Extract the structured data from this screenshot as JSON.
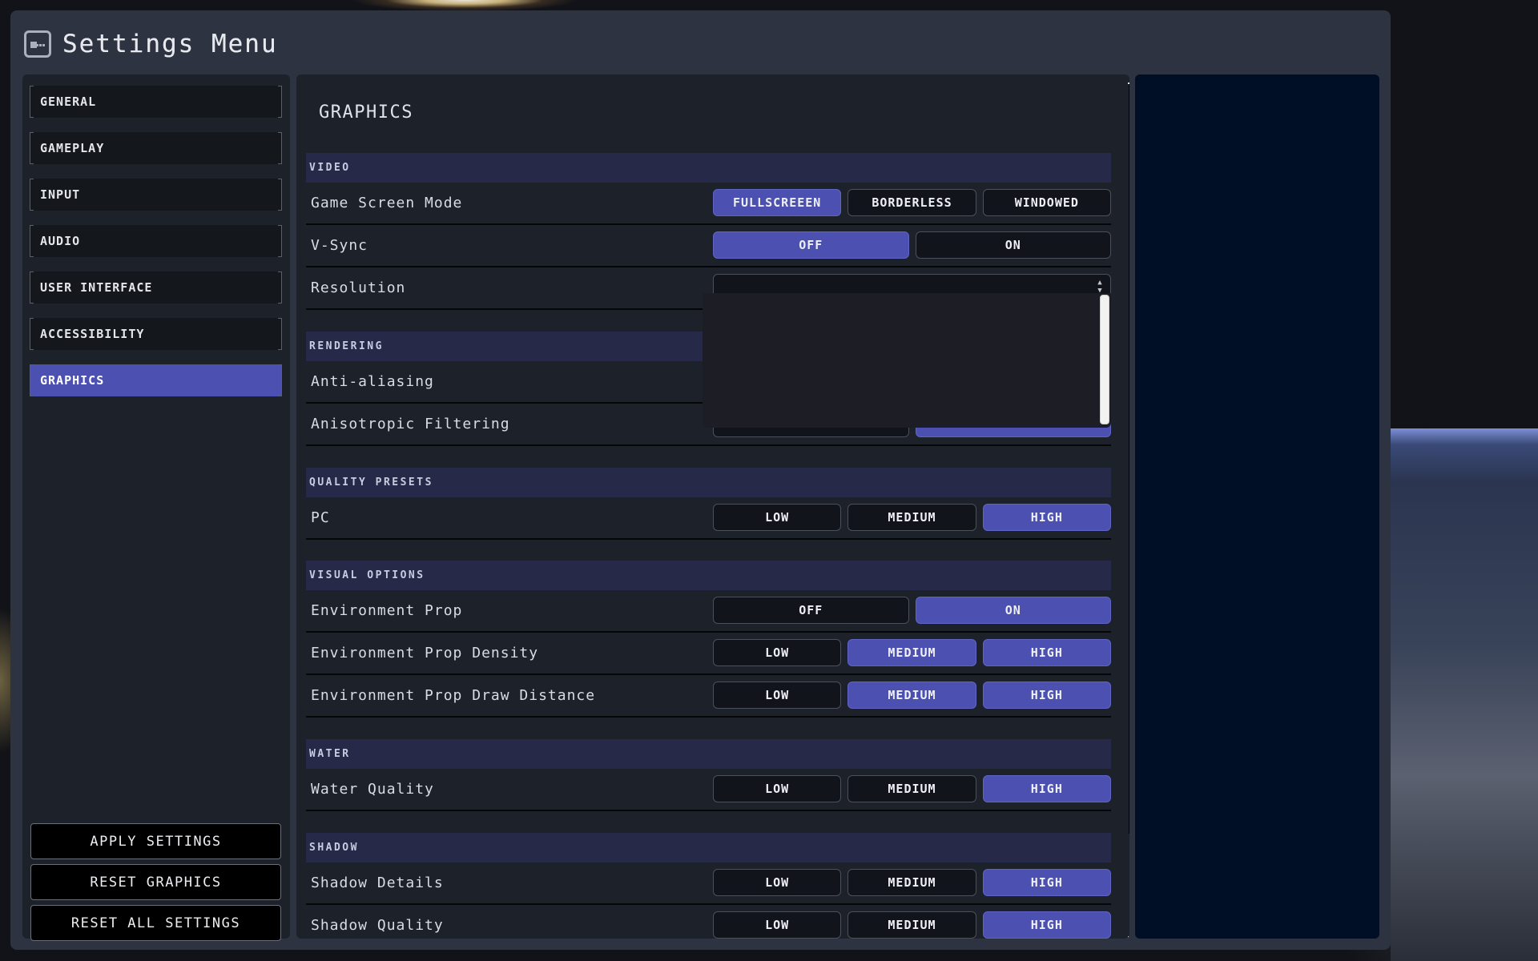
{
  "window": {
    "title": "Settings Menu",
    "title_icon": "back-arrow-icon"
  },
  "sidebar": {
    "items": [
      {
        "label": "GENERAL",
        "active": false
      },
      {
        "label": "GAMEPLAY",
        "active": false
      },
      {
        "label": "INPUT",
        "active": false
      },
      {
        "label": "AUDIO",
        "active": false
      },
      {
        "label": "USER INTERFACE",
        "active": false
      },
      {
        "label": "ACCESSIBILITY",
        "active": false
      },
      {
        "label": "GRAPHICS",
        "active": true
      }
    ],
    "actions": {
      "apply": "APPLY SETTINGS",
      "reset_graphics": "RESET GRAPHICS",
      "reset_all": "RESET ALL SETTINGS"
    }
  },
  "main": {
    "title": "GRAPHICS",
    "sections": {
      "video": {
        "header": "VIDEO",
        "screen_mode": {
          "label": "Game Screen Mode",
          "options": [
            "FULLSCREEEN",
            "BORDERLESS",
            "WINDOWED"
          ],
          "selected": "FULLSCREEEN"
        },
        "vsync": {
          "label": "V-Sync",
          "options": [
            "OFF",
            "ON"
          ],
          "selected": "OFF"
        },
        "resolution": {
          "label": "Resolution",
          "value": "",
          "dropdown_open": true
        }
      },
      "rendering": {
        "header": "RENDERING",
        "anti_aliasing": {
          "label": "Anti-aliasing"
        },
        "anisotropic": {
          "label": "Anisotropic Filtering"
        }
      },
      "quality_presets": {
        "header": "QUALITY PRESETS",
        "pc": {
          "label": "PC",
          "options": [
            "LOW",
            "MEDIUM",
            "HIGH"
          ],
          "selected": [
            "HIGH"
          ]
        }
      },
      "visual_options": {
        "header": "VISUAL OPTIONS",
        "env_prop": {
          "label": "Environment Prop",
          "options": [
            "OFF",
            "ON"
          ],
          "selected": [
            "ON"
          ]
        },
        "env_prop_density": {
          "label": "Environment Prop Density",
          "options": [
            "LOW",
            "MEDIUM",
            "HIGH"
          ],
          "selected": [
            "MEDIUM",
            "HIGH"
          ]
        },
        "env_prop_draw_distance": {
          "label": "Environment Prop Draw Distance",
          "options": [
            "LOW",
            "MEDIUM",
            "HIGH"
          ],
          "selected": [
            "MEDIUM",
            "HIGH"
          ]
        }
      },
      "water": {
        "header": "WATER",
        "water_quality": {
          "label": "Water Quality",
          "options": [
            "LOW",
            "MEDIUM",
            "HIGH"
          ],
          "selected": [
            "HIGH"
          ]
        }
      },
      "shadow": {
        "header": "SHADOW",
        "shadow_details": {
          "label": "Shadow Details",
          "options": [
            "LOW",
            "MEDIUM",
            "HIGH"
          ],
          "selected": [
            "HIGH"
          ]
        },
        "shadow_quality": {
          "label": "Shadow Quality",
          "options": [
            "LOW",
            "MEDIUM",
            "HIGH"
          ],
          "selected": [
            "HIGH"
          ]
        }
      }
    }
  },
  "colors": {
    "accent": "#4c50b0",
    "section_header_bg": "#262a48",
    "panel_bg": "#1d2129",
    "window_bg": "#2d3340",
    "preview_bg": "#000f26"
  }
}
